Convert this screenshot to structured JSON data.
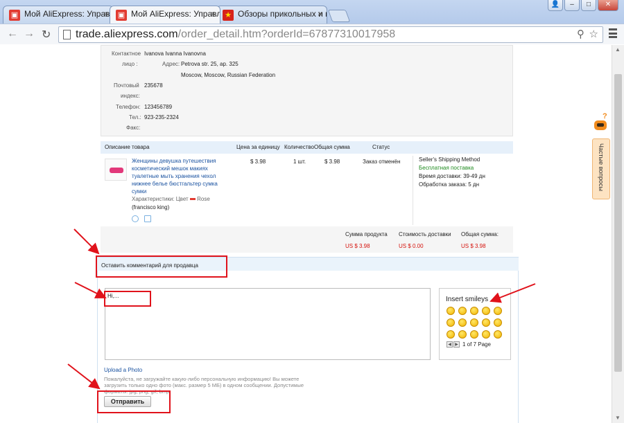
{
  "browser": {
    "tabs": [
      {
        "title": "Мой AliExpress: Управлять"
      },
      {
        "title": "Мой AliExpress: Управлять"
      },
      {
        "title": "Обзоры прикольных и необ"
      }
    ],
    "address": {
      "host": "trade.aliexpress.com",
      "path": "/order_detail.htm?orderId=67877310017958"
    }
  },
  "contact": {
    "person_label": "Контактное",
    "person_label2": "лицо :",
    "person_value": "Ivanova Ivanna Ivanovna",
    "address_label": "Адрес:",
    "address_line1": "Petrova str. 25, ap. 325",
    "address_line2": "Moscow, Moscow, Russian Federation",
    "zip_label": "Почтовый",
    "zip_label2": "индекс:",
    "zip_value": "235678",
    "phone_label": "Телефон:",
    "phone_value": "123456789",
    "tel_label": "Тел.:",
    "tel_value": "923-235-2324",
    "fax_label": "Факс:"
  },
  "product_table": {
    "headers": [
      "Описание товара",
      "Цена за единицу",
      "Количество",
      "Общая сумма",
      "Статус"
    ],
    "item": {
      "name": "Женщины девушка путешествия косметический мешок макиях туалетные мыть хранения чехол нижнее белье бюстгальтер сумка сумки",
      "attr_label": "Характеристики: Цвет",
      "attr_color": "Rose",
      "brand": "(francisco king)",
      "price": "$ 3.98",
      "qty": "1 шт.",
      "total": "$ 3.98",
      "status": "Заказ отменён"
    },
    "shipping": {
      "method": "Seller's Shipping Method",
      "free": "Бесплатная поставка",
      "delivery": "Время доставки: 39-49 дн",
      "processing": "Обработка заказа: 5 дн"
    },
    "totals": {
      "labels": [
        "Сумма продукта",
        "Стоимость доставки",
        "Общая сумма:"
      ],
      "values": [
        "US $ 3.98",
        "US $ 0.00",
        "US $ 3.98"
      ]
    }
  },
  "comment": {
    "header": "Оставить комментарий для продавца",
    "text": "Hi,...",
    "smileys_title": "Insert smileys",
    "pager": "1 of 7 Page",
    "upload": "Upload a Photo",
    "warning": "Пожалуйста, не загружайте какую-либо персональную информацию! Вы можете загрузить только одно фото (макс. размер 5 МБ) в одном сообщении. Допустимые форматы: jpg, png, gif, bmp.",
    "send": "Отправить"
  },
  "help": {
    "label": "Частые вопросы"
  },
  "colors": {
    "highlight": "#e0121b",
    "link": "#1a52a0",
    "price": "#d5120c",
    "free": "#1f8b1f"
  }
}
